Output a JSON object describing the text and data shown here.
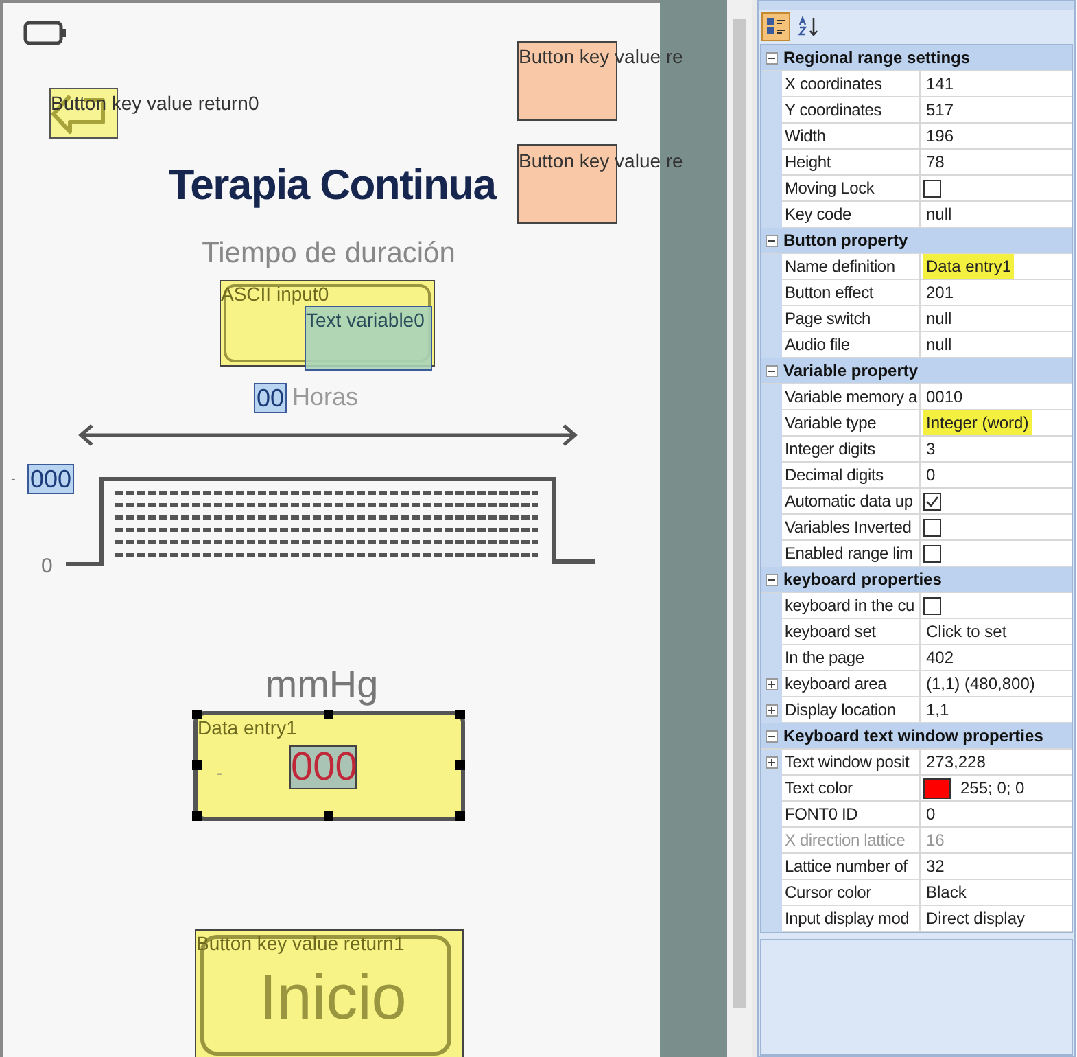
{
  "canvas": {
    "back_button": {
      "label": "Button key value return0"
    },
    "side_buttons": [
      {
        "label": "Button key value re"
      },
      {
        "label": "Button key value re"
      }
    ],
    "title": "Terapia Continua",
    "subtitle": "Tiempo de duración",
    "ascii_input": {
      "label": "ASCII input0"
    },
    "text_variable": {
      "label": "Text variable0"
    },
    "hours": {
      "value": "00",
      "unit": "Horas"
    },
    "pressure": {
      "sign": "-",
      "value": "000",
      "zero": "0"
    },
    "unit": "mmHg",
    "data_entry": {
      "label": "Data entry1",
      "sign": "-",
      "value": "000",
      "selected": true
    },
    "home_button": {
      "label": "Button key value return1",
      "text": "Inicio"
    }
  },
  "properties": {
    "toolbar": [
      {
        "selected": true
      },
      {
        "selected": false
      }
    ],
    "groups": [
      {
        "title": "Regional range settings",
        "expanded": true,
        "rows": [
          {
            "kind": "text",
            "label": "X coordinates",
            "value": "141"
          },
          {
            "kind": "text",
            "label": "Y coordinates",
            "value": "517"
          },
          {
            "kind": "text",
            "label": "Width",
            "value": "196"
          },
          {
            "kind": "text",
            "label": "Height",
            "value": "78"
          },
          {
            "kind": "checkbox",
            "label": "Moving Lock",
            "checked": false
          },
          {
            "kind": "text",
            "label": "Key code",
            "value": "null"
          }
        ]
      },
      {
        "title": "Button property",
        "expanded": true,
        "rows": [
          {
            "kind": "text",
            "label": "Name definition",
            "value": "Data entry1",
            "highlighted": true
          },
          {
            "kind": "text",
            "label": "Button effect",
            "value": "201"
          },
          {
            "kind": "text",
            "label": "Page switch",
            "value": "null"
          },
          {
            "kind": "text",
            "label": "Audio file",
            "value": "null"
          }
        ]
      },
      {
        "title": "Variable property",
        "expanded": true,
        "rows": [
          {
            "kind": "text",
            "label": "Variable memory a",
            "value": "0010"
          },
          {
            "kind": "text",
            "label": "Variable type",
            "value": "Integer (word)",
            "highlighted": true
          },
          {
            "kind": "text",
            "label": "Integer digits",
            "value": "3"
          },
          {
            "kind": "text",
            "label": "Decimal digits",
            "value": "0"
          },
          {
            "kind": "checkbox",
            "label": "Automatic data up",
            "checked": true
          },
          {
            "kind": "checkbox",
            "label": "Variables Inverted",
            "checked": false
          },
          {
            "kind": "checkbox",
            "label": "Enabled range lim",
            "checked": false
          }
        ]
      },
      {
        "title": "keyboard properties",
        "expanded": true,
        "rows": [
          {
            "kind": "checkbox",
            "label": "keyboard in the cu",
            "checked": false
          },
          {
            "kind": "text",
            "label": "keyboard set",
            "value": "Click to set"
          },
          {
            "kind": "text",
            "label": "In the page",
            "value": "402"
          },
          {
            "kind": "text",
            "label": "keyboard area",
            "value": "(1,1) (480,800)",
            "expandable": true
          },
          {
            "kind": "text",
            "label": "Display location",
            "value": "1,1",
            "expandable": true
          }
        ]
      },
      {
        "title": "Keyboard text window properties",
        "expanded": true,
        "rows": [
          {
            "kind": "text",
            "label": "Text window posit",
            "value": "273,228",
            "expandable": true
          },
          {
            "kind": "color",
            "label": "Text color",
            "value": "255; 0; 0",
            "color": "#ff0000"
          },
          {
            "kind": "text",
            "label": "FONT0 ID",
            "value": "0"
          },
          {
            "kind": "text",
            "label": "X direction lattice",
            "value": "16",
            "disabled": true
          },
          {
            "kind": "text",
            "label": "Lattice number of",
            "value": "32"
          },
          {
            "kind": "text",
            "label": "Cursor color",
            "value": "Black"
          },
          {
            "kind": "text",
            "label": "Input display mod",
            "value": "Direct display"
          }
        ]
      }
    ]
  }
}
